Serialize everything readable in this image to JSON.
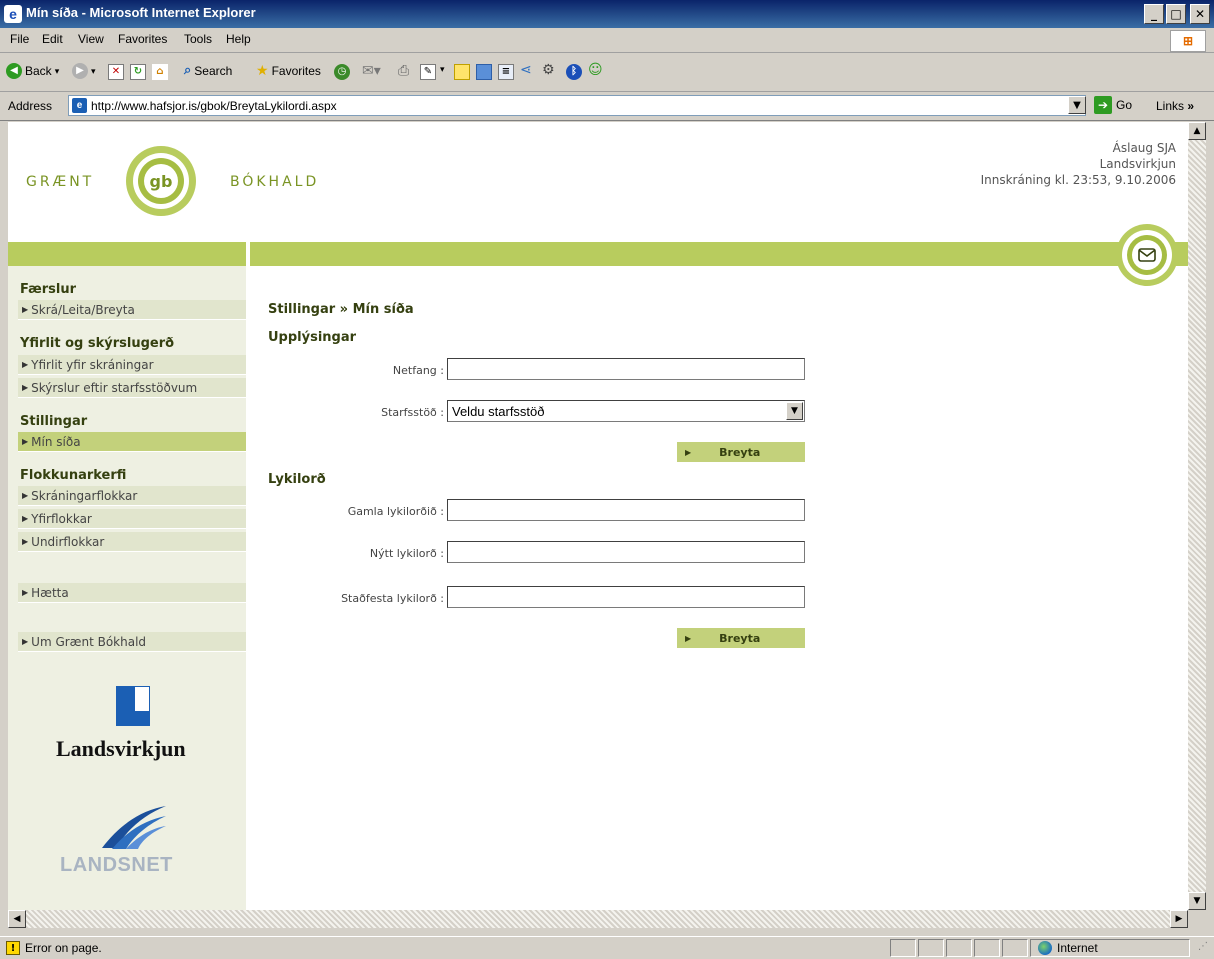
{
  "window": {
    "title": "Mín síða - Microsoft Internet Explorer",
    "min": "_",
    "max": "□",
    "close": "✕"
  },
  "menu": [
    "File",
    "Edit",
    "View",
    "Favorites",
    "Tools",
    "Help"
  ],
  "toolbar": {
    "back": "Back",
    "search": "Search",
    "favorites": "Favorites"
  },
  "address": {
    "label": "Address",
    "url": "http://www.hafsjor.is/gbok/BreytaLykilordi.aspx",
    "go": "Go",
    "links": "Links"
  },
  "site": {
    "logo_left": "GRÆNT",
    "logo_mid": "gb",
    "logo_right": "BÓKHALD",
    "user_name": "Áslaug SJA",
    "user_org": "Landsvirkjun",
    "login_time": "Innskráning kl. 23:53, 9.10.2006"
  },
  "sidebar": {
    "sections": [
      {
        "title": "Færslur",
        "items": [
          "Skrá/Leita/Breyta"
        ]
      },
      {
        "title": "Yfirlit og skýrslugerð",
        "items": [
          "Yfirlit yfir skráningar",
          "Skýrslur eftir starfsstöðvum"
        ]
      },
      {
        "title": "Stillingar",
        "items": [
          "Mín síða"
        ]
      },
      {
        "title": "Flokkunarkerfi",
        "items": [
          "Skráningarflokkar",
          "Yfirflokkar",
          "Undirflokkar"
        ]
      }
    ],
    "extra": [
      "Hætta",
      "Um Grænt Bókhald"
    ],
    "landsvirkjun": "Landsvirkjun",
    "landsnet": "LANDSNET"
  },
  "main": {
    "breadcrumb": "Stillingar » Mín síða",
    "info_title": "Upplýsingar",
    "email_label": "Netfang :",
    "email_value": "",
    "workplace_label": "Starfsstöð :",
    "workplace_value": "Veldu starfsstöð",
    "breyta1": "Breyta",
    "password_title": "Lykilorð",
    "old_pw_label": "Gamla lykilorðið :",
    "new_pw_label": "Nýtt lykilorð :",
    "confirm_pw_label": "Staðfesta lykilorð :",
    "breyta2": "Breyta"
  },
  "status": {
    "text": "Error on page.",
    "zone": "Internet"
  }
}
